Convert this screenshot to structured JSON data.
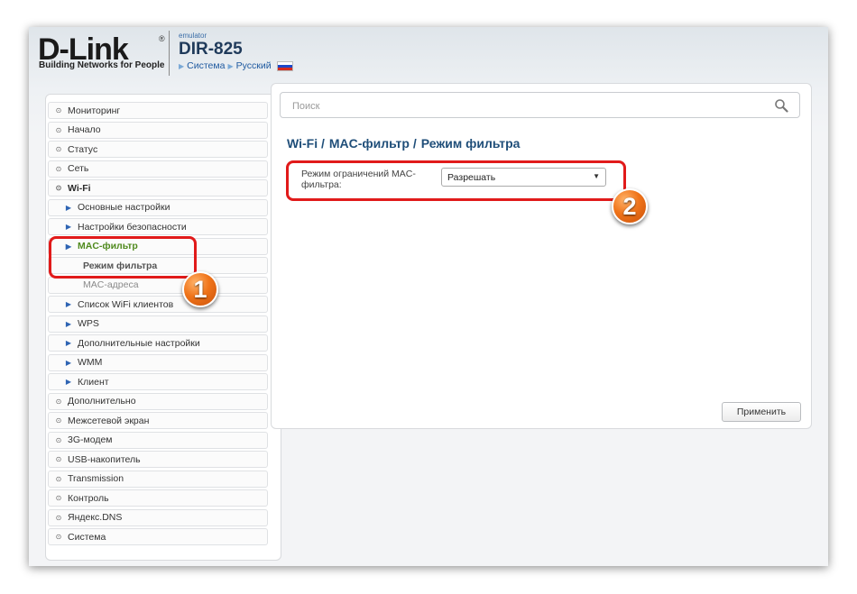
{
  "header": {
    "logo": "D-Link",
    "logo_registered": "®",
    "tagline": "Building Networks for People",
    "emulator": "emulator",
    "model": "DIR-825",
    "crumbs": [
      "Система",
      "Русский"
    ]
  },
  "search": {
    "placeholder": "Поиск"
  },
  "sidebar": {
    "items": [
      {
        "label": "Мониторинг"
      },
      {
        "label": "Начало"
      },
      {
        "label": "Статус"
      },
      {
        "label": "Сеть"
      },
      {
        "label": "Wi-Fi"
      },
      {
        "label": "Основные настройки"
      },
      {
        "label": "Настройки безопасности"
      },
      {
        "label": "MAC-фильтр"
      },
      {
        "label": "Режим фильтра"
      },
      {
        "label": "MAC-адреса"
      },
      {
        "label": "Список WiFi клиентов"
      },
      {
        "label": "WPS"
      },
      {
        "label": "Дополнительные настройки"
      },
      {
        "label": "WMM"
      },
      {
        "label": "Клиент"
      },
      {
        "label": "Дополнительно"
      },
      {
        "label": "Межсетевой экран"
      },
      {
        "label": "3G-модем"
      },
      {
        "label": "USB-накопитель"
      },
      {
        "label": "Transmission"
      },
      {
        "label": "Контроль"
      },
      {
        "label": "Яндекс.DNS"
      },
      {
        "label": "Система"
      }
    ]
  },
  "main": {
    "title_parts": [
      "Wi-Fi /",
      "MAC-фильтр /",
      "Режим фильтра"
    ],
    "field_label": "Режим ограничений MAC-фильтра:",
    "select_value": "Разрешать",
    "apply_label": "Применить"
  },
  "annotations": {
    "badge1": "1",
    "badge2": "2",
    "highlight_color": "#e11a1a",
    "badge_color": "#f0741a"
  },
  "colors": {
    "accent": "#1f4e79",
    "active_item": "#4f8a1d"
  }
}
